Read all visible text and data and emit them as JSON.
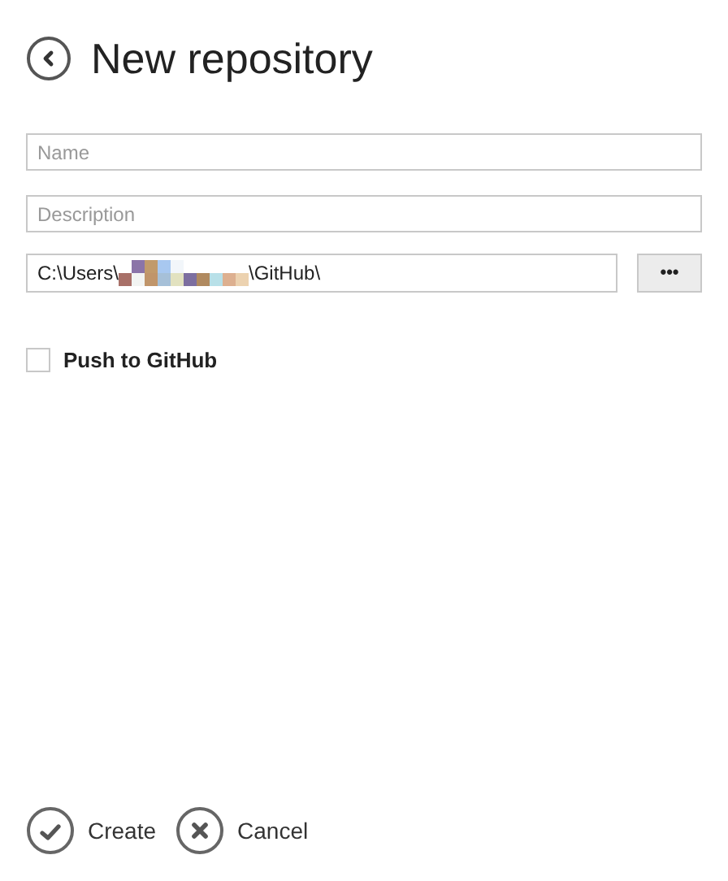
{
  "header": {
    "title": "New repository"
  },
  "fields": [
    {
      "placeholder": "Name"
    },
    {
      "placeholder": "Description"
    }
  ],
  "path": {
    "prefix": "C:\\Users\\",
    "suffix": "\\GitHub\\",
    "browse_label": "•••"
  },
  "push_option": {
    "label": "Push to GitHub",
    "checked": false
  },
  "actions": [
    {
      "kind": "create",
      "label": "Create"
    },
    {
      "kind": "cancel",
      "label": "Cancel"
    }
  ]
}
